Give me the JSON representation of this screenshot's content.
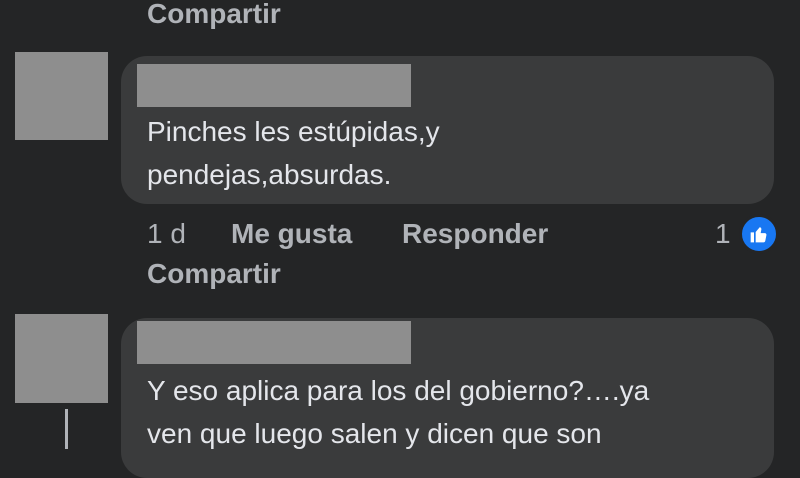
{
  "top_actions": {
    "share": "Compartir"
  },
  "comment1": {
    "text_lines": [
      "Pinches les estúpidas,y",
      "pendejas,absurdas."
    ],
    "time": "1 d",
    "like": "Me gusta",
    "reply": "Responder",
    "reaction_count": "1",
    "share": "Compartir",
    "reaction_icon": "thumbs-up-icon",
    "reaction_color": "#1877f2"
  },
  "comment2": {
    "text_lines": [
      "Y eso aplica para los del gobierno?….ya",
      "ven que luego salen y dicen que son"
    ]
  },
  "colors": {
    "background": "#242526",
    "bubble": "#3a3b3c",
    "text": "#e4e6eb",
    "secondary_text": "#b0b3b8",
    "redaction": "#8e8e8e"
  }
}
